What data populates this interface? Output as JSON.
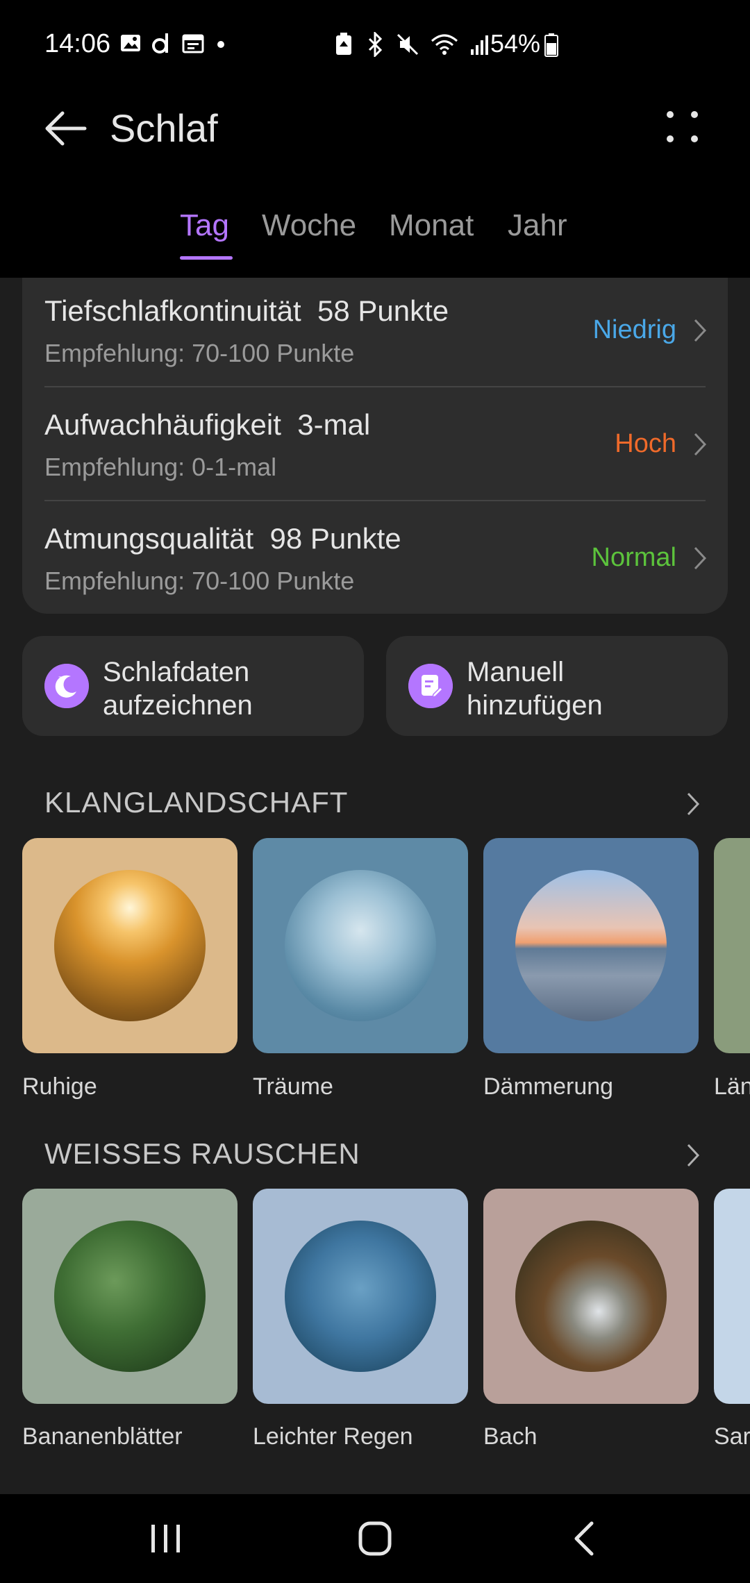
{
  "status_bar": {
    "time": "14:06",
    "battery": "54%"
  },
  "header": {
    "title": "Schlaf"
  },
  "tabs": [
    {
      "label": "Tag",
      "active": true
    },
    {
      "label": "Woche",
      "active": false
    },
    {
      "label": "Monat",
      "active": false
    },
    {
      "label": "Jahr",
      "active": false
    }
  ],
  "metrics": [
    {
      "title": "Tiefschlafkontinuität  58 Punkte",
      "recommendation": "Empfehlung: 70-100 Punkte",
      "status": "Niedrig",
      "status_color": "#4aa8e8"
    },
    {
      "title": "Aufwachhäufigkeit  3-mal",
      "recommendation": "Empfehlung: 0-1-mal",
      "status": "Hoch",
      "status_color": "#f06a2a"
    },
    {
      "title": "Atmungsqualität  98 Punkte",
      "recommendation": "Empfehlung: 70-100 Punkte",
      "status": "Normal",
      "status_color": "#5cc33c"
    }
  ],
  "actions": [
    {
      "label": "Schlafdaten\naufzeichnen",
      "icon": "sleep-moon-icon"
    },
    {
      "label": "Manuell\nhinzufügen",
      "icon": "note-edit-icon"
    }
  ],
  "soundscape": {
    "title": "KLANGLANDSCHAFT",
    "items": [
      {
        "label": "Ruhige",
        "bg": "#dcb98a"
      },
      {
        "label": "Träume",
        "bg": "#5e8aa6"
      },
      {
        "label": "Dämmerung",
        "bg": "#557aa0"
      },
      {
        "label": "Län",
        "bg": "#8a9c7c"
      }
    ]
  },
  "white_noise": {
    "title": "WEISSES RAUSCHEN",
    "items": [
      {
        "label": "Bananenblätter",
        "bg": "#9aaa9a"
      },
      {
        "label": "Leichter Regen",
        "bg": "#a7bbd3"
      },
      {
        "label": "Bach",
        "bg": "#b9a09a"
      },
      {
        "label": "Sar",
        "bg": "#c4d6e8"
      }
    ]
  },
  "colors": {
    "accent": "#b476ff",
    "card_bg": "#2d2d2d",
    "page_bg": "#1e1e1e"
  }
}
